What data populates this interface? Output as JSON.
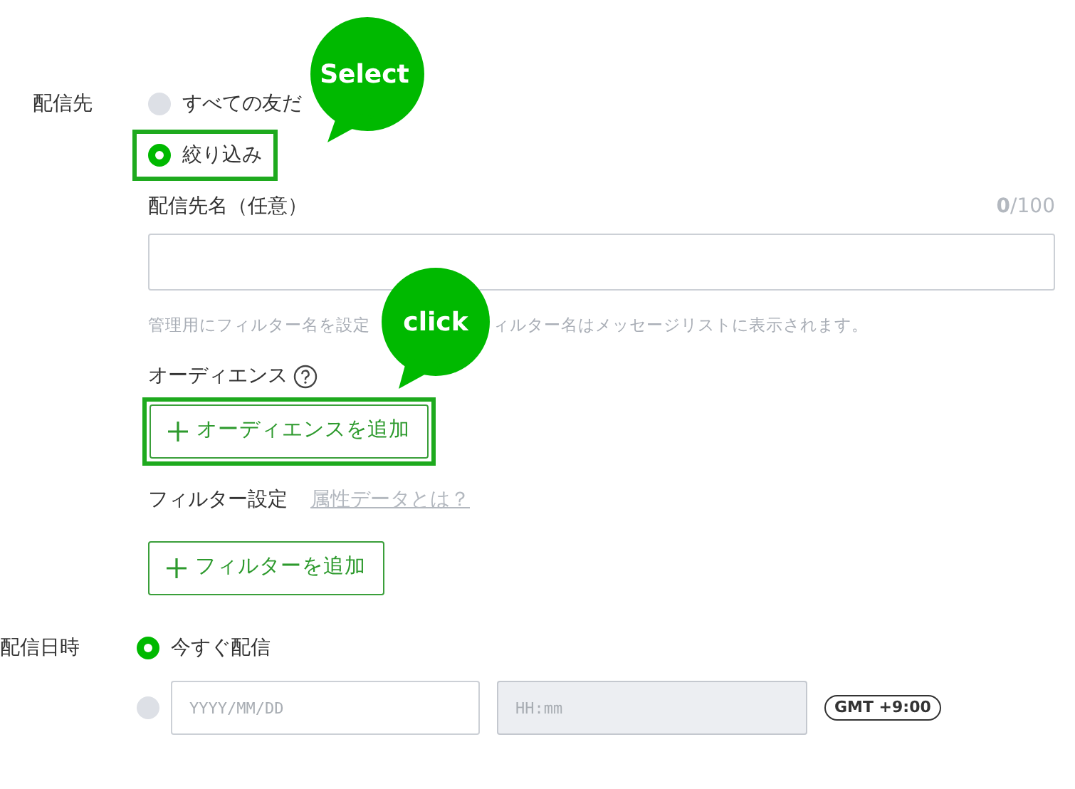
{
  "recipient": {
    "label": "配信先",
    "options": [
      {
        "label": "すべての友だ",
        "selected": false,
        "highlighted": false
      },
      {
        "label": "絞り込み",
        "selected": true,
        "highlighted": true
      }
    ],
    "name_field": {
      "label": "配信先名（任意）",
      "counter": "**0**/100",
      "hint_parts": [
        "管理用にフィルター名を設定",
        "ィルター名はメッセージリストに表示されます。"
      ]
    },
    "audience": {
      "label": "オーディエンス",
      "button": {
        "label": "オーディエンスを追加",
        "highlighted": true
      }
    },
    "filter": {
      "label": "フィルター設定",
      "link": "属性データとは？",
      "button": "フィルターを追加"
    }
  },
  "schedule": {
    "label": "配信日時",
    "options": [
      {
        "kind": "now",
        "label": "今すぐ配信",
        "selected": true
      },
      {
        "kind": "datetime",
        "selected": false,
        "date_placeholder": "YYYY/MM/DD",
        "time_placeholder": "HH:mm",
        "time_disabled": true,
        "timezone": "GMT +9:00"
      }
    ]
  },
  "callouts": [
    {
      "text": "Select"
    },
    {
      "text": "click"
    }
  ]
}
